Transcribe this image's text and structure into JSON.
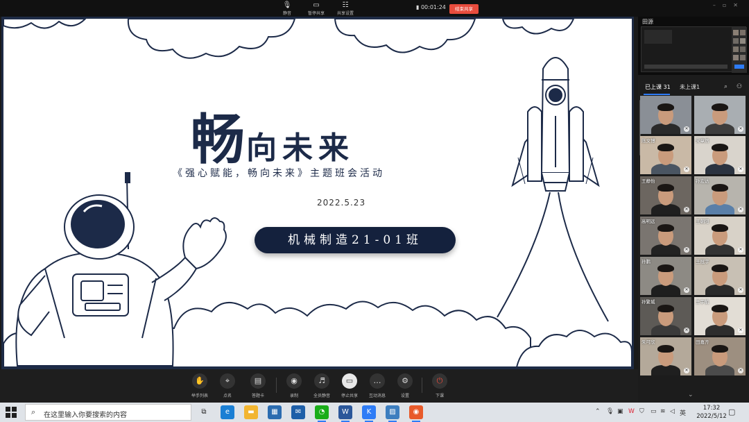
{
  "topbar": {
    "controls": [
      {
        "label": "静音",
        "icon": "mic-icon"
      },
      {
        "label": "暂停共享",
        "icon": "screen-icon"
      },
      {
        "label": "共享设置",
        "icon": "people-icon"
      }
    ],
    "timer": "00:01:24",
    "end_share": "结束共享"
  },
  "slide": {
    "title_big": "畅",
    "title_rest": "向未来",
    "subtitle": "《强心赋能，畅向未来》主题班会活动",
    "date": "2022.5.23",
    "class_name": "机械制造21-01班"
  },
  "panel": {
    "presenter": "田源",
    "tabs": [
      {
        "label": "已上课",
        "count": "31"
      },
      {
        "label": "未上课",
        "count": "1"
      }
    ],
    "participants": [
      {
        "name": "",
        "shirt": "#2a2a2a",
        "bg": "#8a8f96"
      },
      {
        "name": "",
        "shirt": "#3d3d3d",
        "bg": "#a9aeb2"
      },
      {
        "name": "陈文博",
        "shirt": "#4a5562",
        "bg": "#c9b9a6"
      },
      {
        "name": "宋章然",
        "shirt": "#2b3340",
        "bg": "#d9d4cc"
      },
      {
        "name": "王静怡",
        "shirt": "#1f1f1f",
        "bg": "#6c6660"
      },
      {
        "name": "孙宏达",
        "shirt": "#5a7fa8",
        "bg": "#b7b4ad"
      },
      {
        "name": "高明远",
        "shirt": "#222",
        "bg": "#7a7570"
      },
      {
        "name": "王朝阳",
        "shirt": "#333",
        "bg": "#d8d2c8"
      },
      {
        "name": "孙鹏",
        "shirt": "#1e1e1e",
        "bg": "#8d8a84"
      },
      {
        "name": "王冠宇",
        "shirt": "#2a2a2a",
        "bg": "#c8c0b4"
      },
      {
        "name": "孙繁城",
        "shirt": "#3a3a3a",
        "bg": "#5d5a56"
      },
      {
        "name": "王宇航",
        "shirt": "#2d2d2d",
        "bg": "#e2ddd5"
      },
      {
        "name": "朱可欣",
        "shirt": "#1f1f1f",
        "bg": "#b4a99a"
      },
      {
        "name": "田嘉齐",
        "shirt": "#4b4b4b",
        "bg": "#9d8f80"
      }
    ]
  },
  "toolbar": {
    "tools": [
      {
        "label": "举手列表",
        "icon": "hand-icon"
      },
      {
        "label": "点名",
        "icon": "location-icon"
      },
      {
        "label": "答题卡",
        "icon": "card-icon"
      },
      {
        "label": "录制",
        "icon": "record-icon"
      },
      {
        "label": "全员静音",
        "icon": "mute-all-icon"
      },
      {
        "label": "停止共享",
        "icon": "stop-share-icon"
      },
      {
        "label": "互动消息",
        "icon": "chat-icon"
      },
      {
        "label": "设置",
        "icon": "gear-icon"
      },
      {
        "label": "下课",
        "icon": "power-icon"
      }
    ]
  },
  "taskbar": {
    "search_placeholder": "在这里输入你要搜索的内容",
    "time": "17:32",
    "date": "2022/5/12",
    "ime": "英",
    "apps": [
      {
        "icon": "task-view-icon",
        "color": "#dfe3e8"
      },
      {
        "icon": "edge-icon",
        "color": "#1a7fd4"
      },
      {
        "icon": "folder-icon",
        "color": "#f2b530"
      },
      {
        "icon": "store-icon",
        "color": "#2b6cb0"
      },
      {
        "icon": "mail-icon",
        "color": "#1e5fa8"
      },
      {
        "icon": "wechat-icon",
        "color": "#1aad19"
      },
      {
        "icon": "word-icon",
        "color": "#2b579a"
      },
      {
        "icon": "class-app-icon",
        "color": "#2e7cf6"
      },
      {
        "icon": "photos-icon",
        "color": "#3d7ebf"
      },
      {
        "icon": "record-app-icon",
        "color": "#e85a2a"
      }
    ]
  }
}
